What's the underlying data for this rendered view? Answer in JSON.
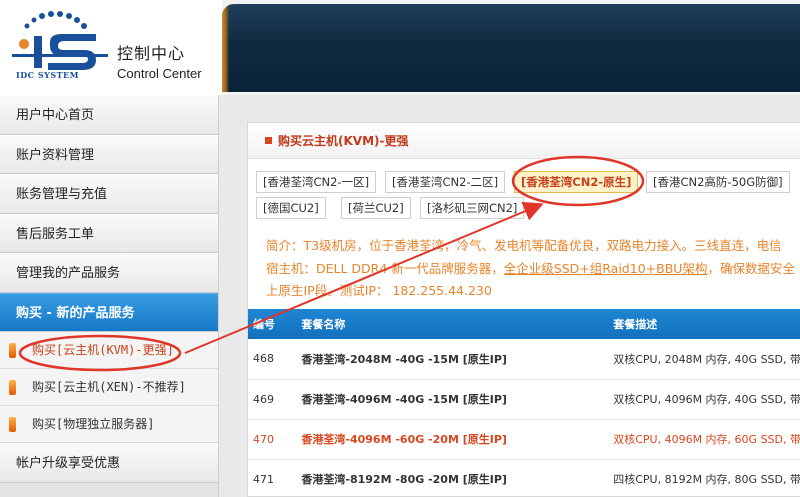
{
  "logo": {
    "mark_text": "IDC SYSTEM",
    "title_cn": "控制中心",
    "title_en": "Control Center"
  },
  "sidebar": {
    "items": [
      {
        "label": "用户中心首页"
      },
      {
        "label": "账户资料管理"
      },
      {
        "label": "账务管理与充值"
      },
      {
        "label": "售后服务工单"
      },
      {
        "label": "管理我的产品服务"
      },
      {
        "label": "购买 - 新的产品服务"
      }
    ],
    "subitems": [
      {
        "label": "购买[云主机(KVM)-更强]"
      },
      {
        "label": "购买[云主机(XEN)-不推荐]"
      },
      {
        "label": "购买[物理独立服务器]"
      }
    ],
    "last_item": {
      "label": "帐户升级享受优惠"
    }
  },
  "panel": {
    "title": "购买云主机(KVM)-更强",
    "tabs": [
      "[香港荃湾CN2-一区]",
      "[香港荃湾CN2-二区]",
      "[香港荃湾CN2-原生]",
      "[香港CN2高防-50G防御]",
      "[德国CU2]",
      "[荷兰CU2]",
      "[洛杉矶三网CN2]"
    ],
    "intro": {
      "line1": "简介：T3级机房，位于香港荃湾，冷气、发电机等配备优良，双路电力接入。三线直连，电信",
      "line2_a": "宿主机：DELL DDR4 新一代品牌服务器，",
      "line2_b": "全企业级SSD+组Raid10+BBU架构",
      "line2_c": "，确保数据安全",
      "line3": "上原生IP段。测试IP： 182.255.44.230"
    },
    "table": {
      "headers": [
        "编号",
        "套餐名称",
        "套餐描述"
      ],
      "rows": [
        {
          "id": "468",
          "name": "香港荃湾-2048M -40G -15M [原生IP]",
          "desc": "双核CPU, 2048M 内存, 40G SSD, 带"
        },
        {
          "id": "469",
          "name": "香港荃湾-4096M -40G -15M [原生IP]",
          "desc": "双核CPU, 4096M 内存, 40G SSD, 带"
        },
        {
          "id": "470",
          "name": "香港荃湾-4096M -60G -20M [原生IP]",
          "desc": "双核CPU, 4096M 内存, 60G SSD, 带"
        },
        {
          "id": "471",
          "name": "香港荃湾-8192M -80G -20M [原生IP]",
          "desc": "四核CPU, 8192M 内存, 80G SSD, 带"
        }
      ]
    }
  },
  "colors": {
    "accent_red": "#d9461f",
    "nav_blue": "#1479c9",
    "intro_orange": "#e8842b",
    "tab_highlight": "#fdf2c9"
  }
}
